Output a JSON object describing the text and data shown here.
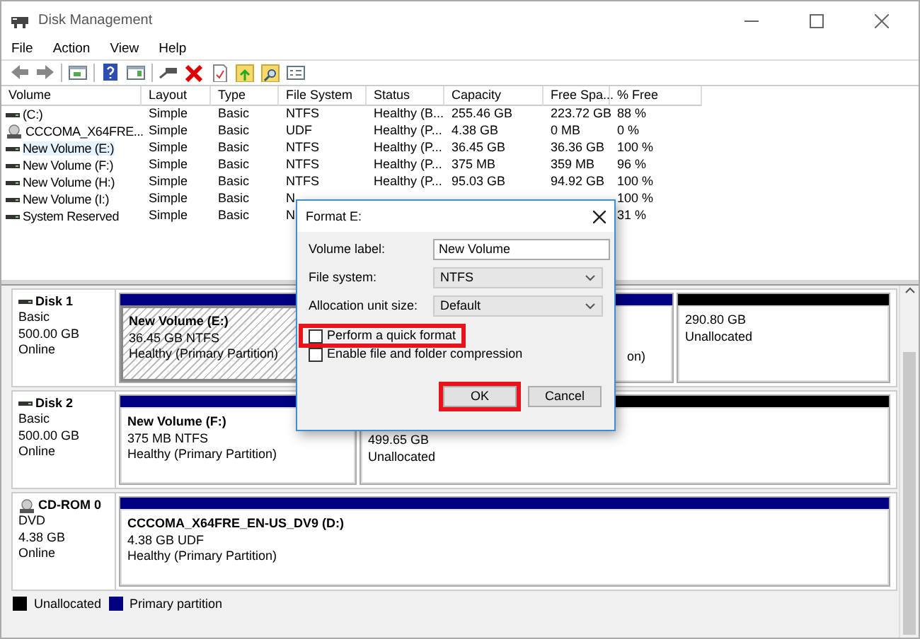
{
  "window": {
    "title": "Disk Management"
  },
  "menu": [
    "File",
    "Action",
    "View",
    "Help"
  ],
  "table": {
    "columns": [
      "Volume",
      "Layout",
      "Type",
      "File System",
      "Status",
      "Capacity",
      "Free Spa...",
      "% Free"
    ],
    "rows": [
      {
        "kind": "disk",
        "selected": false,
        "cells": [
          "(C:)",
          "Simple",
          "Basic",
          "NTFS",
          "Healthy (B...",
          "255.46 GB",
          "223.72 GB",
          "88 %"
        ]
      },
      {
        "kind": "cd",
        "selected": false,
        "cells": [
          "CCCOMA_X64FRE...",
          "Simple",
          "Basic",
          "UDF",
          "Healthy (P...",
          "4.38 GB",
          "0 MB",
          "0 %"
        ]
      },
      {
        "kind": "disk",
        "selected": true,
        "cells": [
          "New Volume (E:)",
          "Simple",
          "Basic",
          "NTFS",
          "Healthy (P...",
          "36.45 GB",
          "36.36 GB",
          "100 %"
        ]
      },
      {
        "kind": "disk",
        "selected": false,
        "cells": [
          "New Volume (F:)",
          "Simple",
          "Basic",
          "NTFS",
          "Healthy (P...",
          "375 MB",
          "359 MB",
          "96 %"
        ]
      },
      {
        "kind": "disk",
        "selected": false,
        "cells": [
          "New Volume (H:)",
          "Simple",
          "Basic",
          "NTFS",
          "Healthy (P...",
          "95.03 GB",
          "94.92 GB",
          "100 %"
        ]
      },
      {
        "kind": "disk",
        "selected": false,
        "cells": [
          "New Volume (I:)",
          "Simple",
          "Basic",
          "N",
          null,
          null,
          null,
          "100 %"
        ]
      },
      {
        "kind": "disk",
        "selected": false,
        "cells": [
          "System Reserved",
          "Simple",
          "Basic",
          "N",
          null,
          null,
          null,
          "31 %"
        ]
      }
    ]
  },
  "disks": [
    {
      "kind": "disk",
      "name": "Disk 1",
      "type": "Basic",
      "size": "500.00 GB",
      "status": "Online",
      "partitions": [
        {
          "kind": "primary",
          "selected": true,
          "lines": [
            "New Volume  (E:)",
            "36.45 GB NTFS",
            "Healthy (Primary Partition)"
          ]
        },
        {
          "kind": "primary",
          "selected": false,
          "lines": [
            "on)"
          ]
        },
        {
          "kind": "unallocated",
          "selected": false,
          "lines": [
            "290.80 GB",
            "Unallocated"
          ]
        }
      ]
    },
    {
      "kind": "disk",
      "name": "Disk 2",
      "type": "Basic",
      "size": "500.00 GB",
      "status": "Online",
      "partitions": [
        {
          "kind": "primary",
          "selected": false,
          "lines": [
            "New Volume  (F:)",
            "375 MB NTFS",
            "Healthy (Primary Partition)"
          ]
        },
        {
          "kind": "unallocated",
          "selected": false,
          "lines": [
            "499.65 GB",
            "Unallocated"
          ]
        }
      ]
    },
    {
      "kind": "cd",
      "name": "CD-ROM 0",
      "type": "DVD",
      "size": "4.38 GB",
      "status": "Online",
      "partitions": [
        {
          "kind": "primary",
          "selected": false,
          "lines": [
            "CCCOMA_X64FRE_EN-US_DV9  (D:)",
            "4.38 GB UDF",
            "Healthy (Primary Partition)"
          ]
        }
      ]
    }
  ],
  "legend": [
    {
      "label": "Unallocated",
      "color": "#000000"
    },
    {
      "label": "Primary partition",
      "color": "#000080"
    }
  ],
  "dialog": {
    "title": "Format E:",
    "fields": [
      {
        "kind": "text",
        "label": "Volume label:",
        "value": "New Volume"
      },
      {
        "kind": "select",
        "label": "File system:",
        "value": "NTFS"
      },
      {
        "kind": "select",
        "label": "Allocation unit size:",
        "value": "Default"
      }
    ],
    "checkboxes": [
      {
        "label": "Perform a quick format",
        "checked": false,
        "highlighted": true
      },
      {
        "label": "Enable file and folder compression",
        "checked": false,
        "highlighted": false
      }
    ],
    "buttons": [
      {
        "label": "OK",
        "highlighted": true
      },
      {
        "label": "Cancel",
        "highlighted": false
      }
    ]
  }
}
